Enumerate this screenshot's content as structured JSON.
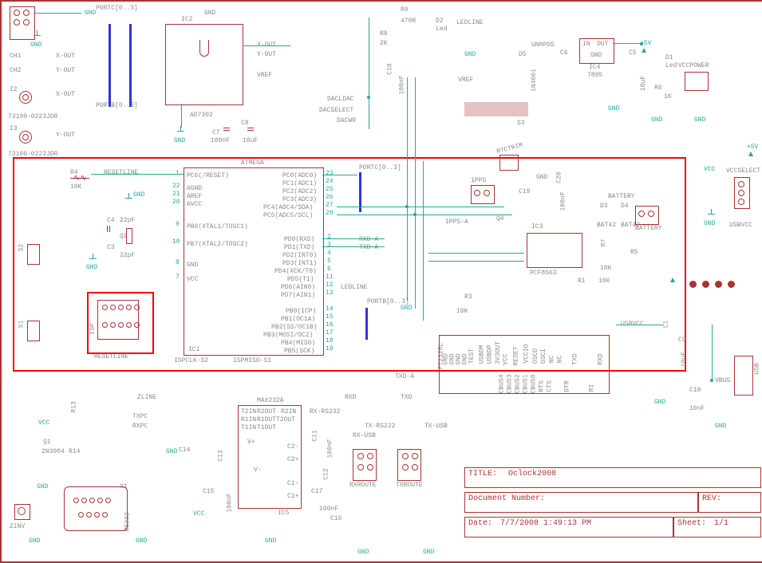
{
  "board_name": "Oclock2008",
  "date_time": "7/7/2008 1:49:13 PM",
  "sheet": "1/1",
  "doc_no_label": "Document Number:",
  "rev_label": "REV:",
  "title_label": "TITLE:",
  "date_label": "Date:",
  "sheet_label": "Sheet:",
  "ic1": {
    "ref": "IC1",
    "type": "ATMEGA",
    "left": [
      "PC6(/RESET)",
      "",
      "AGND",
      "AREF",
      "AVCC",
      "",
      "PB6(XTAL1/TOSC1)",
      "",
      "PB7(XTAL2/TOSC2)",
      "",
      "GND",
      "",
      "VCC"
    ],
    "right": [
      "PC0(ADC0)",
      "PC1(ADC1)",
      "PC2(ADC2)",
      "PC3(ADC3)",
      "PC4(ADC4/SDA)",
      "PC5(ADC5/SCL)",
      "",
      "PD0(RXD)",
      "PD1(TXD)",
      "PD2(INT0)",
      "PD3(INT1)",
      "PD4(XCK/T0)",
      "PD5(T1)",
      "PD6(AIN0)",
      "PD7(AIN1)",
      "",
      "PB0(ICP)",
      "PB1(OC1A)",
      "PB2(SS/OC1B)",
      "PB3(MOSI/OC2)",
      "PB4(MISO)",
      "PB5(SCK)"
    ],
    "pins_l": [
      "1",
      "22",
      "21",
      "20",
      "9",
      "10",
      "8",
      "7"
    ],
    "pins_r": [
      "23",
      "24",
      "25",
      "26",
      "27",
      "28",
      "2",
      "3",
      "4",
      "5",
      "6",
      "11",
      "12",
      "13",
      "14",
      "15",
      "16",
      "17",
      "18",
      "19"
    ]
  },
  "ic2": {
    "ref": "IC2",
    "type": "AD7302"
  },
  "ic3": {
    "ref": "IC3",
    "type": "PCF8563"
  },
  "ic4": {
    "ref": "IC4",
    "type": "7805",
    "pins": [
      "IN",
      "OUT",
      "GND"
    ]
  },
  "ic5": {
    "ref": "IC5",
    "type": "MAX232A",
    "left": [
      "T2IN",
      "R2OUT",
      "R1IN",
      "R1OUT",
      "T1IN",
      "T1OUT"
    ],
    "right": [
      "R2IN",
      "T2OUT",
      "C2-",
      "C2+",
      "V-",
      "C1-",
      "C1+"
    ],
    "top": [
      "V+"
    ]
  },
  "ft232": {
    "ref": "FT232RL",
    "pins": [
      "GND",
      "GND",
      "GND",
      "GND",
      "TEST",
      "USBDM",
      "USBDP",
      "3V3OUT",
      "VCC",
      "RESET",
      "VCCIO",
      "OSCO",
      "OSCI",
      "NC",
      "NC",
      "TXD",
      "",
      "RTS",
      "",
      "CTS",
      "",
      "CBUS0",
      "CBUS1",
      "CBUS2",
      "CBUS3",
      "CBUS4",
      "DTR",
      "RXD",
      "RI"
    ]
  },
  "signals": {
    "gnd": "GND",
    "vcc": "VCC",
    "+5v": "+5V",
    "vref": "VREF",
    "portc": "PORTC[0..3]",
    "portb": "PORTB[0..3]",
    "xout": "X-OUT",
    "yout": "Y-OUT",
    "dacldac": "DACLDAC",
    "dacselect": "DACSELECT",
    "dacwr": "DACWR",
    "ledline": "LEDLINE",
    "resetline": "RESETLINE",
    "unrpos": "UNRPOS",
    "rtctrim": "RTCTRIM",
    "1pps": "1PPS",
    "1ppsa": "1PPS-A",
    "battery": "BATTERY",
    "vccselect": "VCCSELECT",
    "usbvcc": "USBVCC",
    "vccpower": "VCCPOWER",
    "txda": "TXD-A",
    "rxda": "RXD-A",
    "txusb": "TX-USB",
    "rxusb": "RX-USB",
    "txrs232": "TX-RS232",
    "rxrs232": "RX-RS232",
    "rxroute": "RXROUTE",
    "txroute": "TXROUTE",
    "txpc": "TXPC",
    "rxpc": "RXPC",
    "ispmiso": "ISPMISO-S1",
    "ispclk": "ISPCLK-S2",
    "zinv": "ZINV",
    "zline": "ZLINE",
    "rxd": "RXD",
    "txd": "TXD",
    "usb": "USB",
    "vbus": "VBUS"
  },
  "components": {
    "ch1": "CH1",
    "ch2": "CH2",
    "i2": "I2",
    "i3": "I3",
    "r4": "R4",
    "r4v": "10K",
    "c4": "C4",
    "c4v": "22pF",
    "c3": "C3",
    "c3v": "22pF",
    "q2": "Q2",
    "c7": "C7",
    "c7v": "100nF",
    "c8": "C8",
    "c8v": "10uF",
    "r9": "R9",
    "r9v": "470R",
    "r8": "R8",
    "r8v": "2K",
    "d2": "D2",
    "d2v": "Led",
    "c18": "C18",
    "c18v": "100nF",
    "d5": "D5",
    "d5v": "1N4001",
    "c6": "C6",
    "c5": "C5",
    "c5v": "10uF",
    "r6": "R6",
    "r6v": "1K",
    "d1": "D1",
    "d1v": "Led",
    "c20": "C20",
    "c20v": "100nF",
    "c19": "C19",
    "d3": "D3",
    "d4": "D4",
    "bat": "BAT42",
    "r7": "R7",
    "r7v": "10K",
    "r1": "R1",
    "r1v": "10K",
    "r5": "R5",
    "r3": "R3",
    "r3v": "10K",
    "q4": "Q4",
    "l1": "L1",
    "c9": "C9",
    "c9v": "10uF",
    "c10": "C10",
    "c10v": "10nF",
    "c11": "C11",
    "c12": "C12",
    "c13": "C13",
    "c14": "C14",
    "c15": "C15",
    "c16": "C16",
    "c17": "C17",
    "c11v": "100nF",
    "c15v": "100nF",
    "c16v": "100nF",
    "r13": "R13",
    "r14": "R14",
    "x1": "X1",
    "isp": "ISP",
    "zin": "73100-0223JDR",
    "q1": "Q1",
    "t2n": "2N3904",
    "s1": "S1",
    "s2": "S2",
    "s3": "S3",
    "rs232": "RS232"
  }
}
